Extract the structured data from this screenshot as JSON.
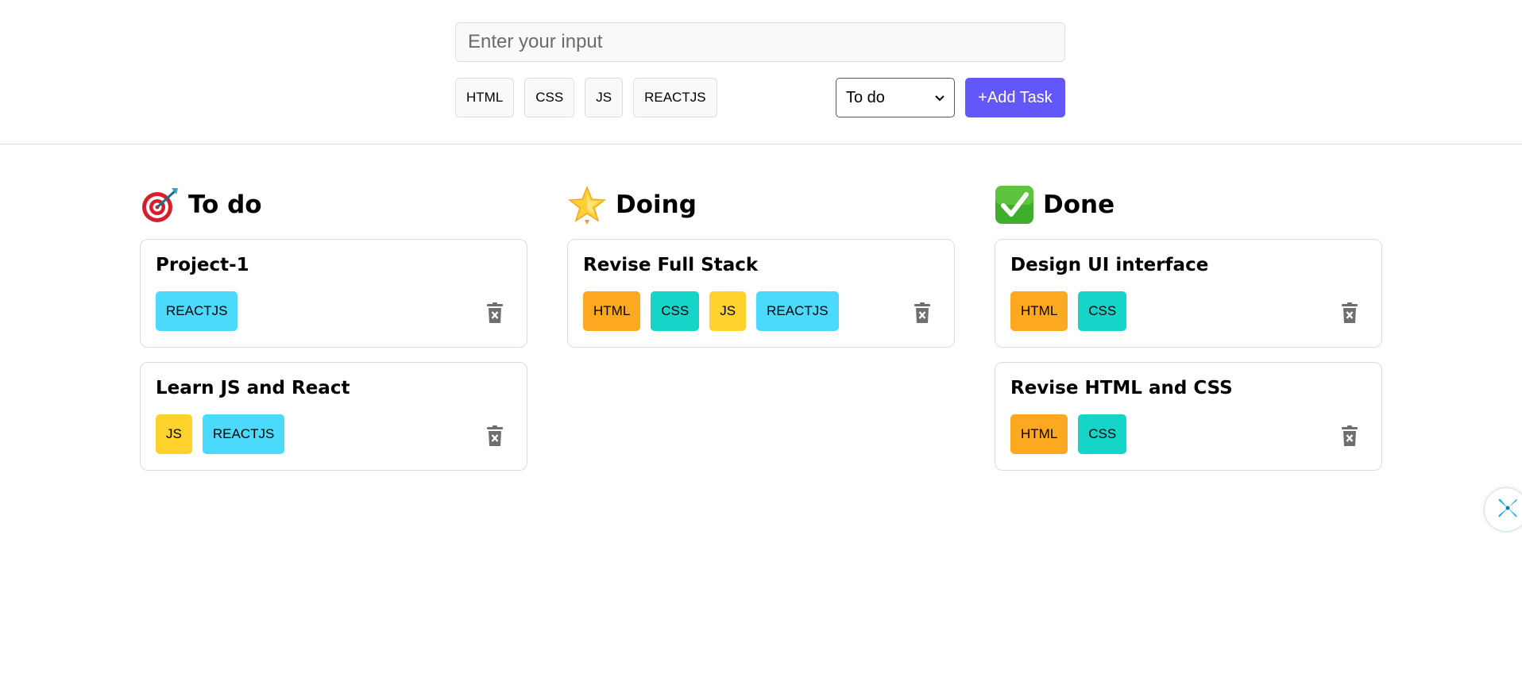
{
  "form": {
    "input_placeholder": "Enter your input",
    "tag_options": [
      "HTML",
      "CSS",
      "JS",
      "REACTJS"
    ],
    "status_selected": "To do",
    "add_button_label": "+Add Task"
  },
  "tag_colors": {
    "HTML": "#fda821",
    "CSS": "#15d4c8",
    "JS": "#ffd12c",
    "REACTJS": "#4cdafc"
  },
  "colors": {
    "accent": "#6457f9",
    "border": "#dcdcdc"
  },
  "columns": [
    {
      "title": "To do",
      "icon": "target-icon",
      "cards": [
        {
          "title": "Project-1",
          "tags": [
            "REACTJS"
          ]
        },
        {
          "title": "Learn JS and React",
          "tags": [
            "JS",
            "REACTJS"
          ]
        }
      ]
    },
    {
      "title": "Doing",
      "icon": "star-icon",
      "cards": [
        {
          "title": "Revise Full Stack",
          "tags": [
            "HTML",
            "CSS",
            "JS",
            "REACTJS"
          ]
        }
      ]
    },
    {
      "title": "Done",
      "icon": "check-mark-icon",
      "cards": [
        {
          "title": "Design UI interface",
          "tags": [
            "HTML",
            "CSS"
          ]
        },
        {
          "title": "Revise HTML and CSS",
          "tags": [
            "HTML",
            "CSS"
          ]
        }
      ]
    }
  ]
}
